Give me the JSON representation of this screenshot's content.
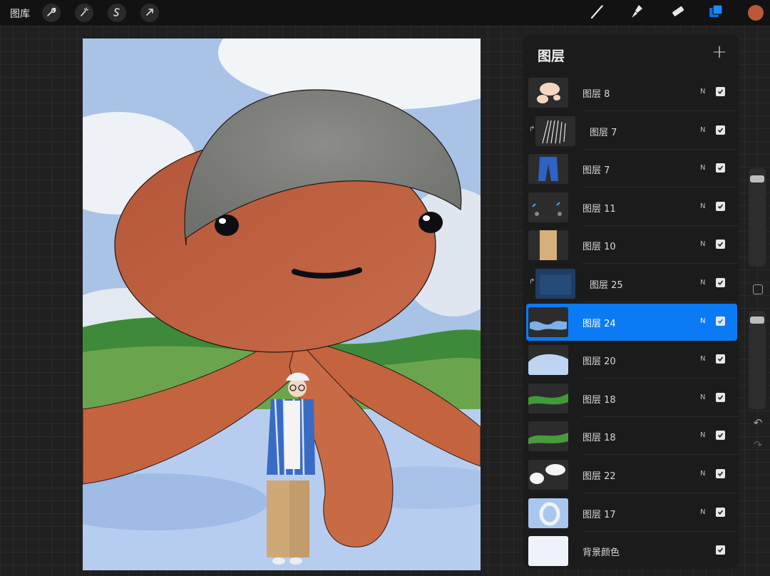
{
  "toolbar": {
    "gallery_label": "图库",
    "tools_left": [
      "wrench-icon",
      "magic-wand-icon",
      "selection-icon",
      "transform-arrow-icon"
    ],
    "tools_right": [
      "brush-icon",
      "smudge-icon",
      "eraser-icon",
      "layers-icon"
    ],
    "current_color": "#b85a3a"
  },
  "layers_panel": {
    "title": "图层",
    "add_label": "+",
    "layers": [
      {
        "name": "图层 8",
        "mode": "N",
        "visible": true,
        "clipped": false,
        "selected": false,
        "thumb": "skin-patches"
      },
      {
        "name": "图层 7",
        "mode": "N",
        "visible": true,
        "clipped": true,
        "selected": false,
        "thumb": "stripes"
      },
      {
        "name": "图层 7",
        "mode": "N",
        "visible": true,
        "clipped": false,
        "selected": false,
        "thumb": "blue-shirt"
      },
      {
        "name": "图层 11",
        "mode": "N",
        "visible": true,
        "clipped": false,
        "selected": false,
        "thumb": "dark-details"
      },
      {
        "name": "图层 10",
        "mode": "N",
        "visible": true,
        "clipped": false,
        "selected": false,
        "thumb": "khaki-pants"
      },
      {
        "name": "图层 25",
        "mode": "N",
        "visible": true,
        "clipped": true,
        "selected": false,
        "thumb": "blue-texture"
      },
      {
        "name": "图层 24",
        "mode": "N",
        "visible": true,
        "clipped": false,
        "selected": true,
        "thumb": "water"
      },
      {
        "name": "图层 20",
        "mode": "N",
        "visible": true,
        "clipped": false,
        "selected": false,
        "thumb": "light-sky"
      },
      {
        "name": "图层 18",
        "mode": "N",
        "visible": true,
        "clipped": false,
        "selected": false,
        "thumb": "green-hill"
      },
      {
        "name": "图层 18",
        "mode": "N",
        "visible": true,
        "clipped": false,
        "selected": false,
        "thumb": "green-hill-2"
      },
      {
        "name": "图层 22",
        "mode": "N",
        "visible": true,
        "clipped": false,
        "selected": false,
        "thumb": "clouds"
      },
      {
        "name": "图层 17",
        "mode": "N",
        "visible": true,
        "clipped": false,
        "selected": false,
        "thumb": "blue-ring"
      },
      {
        "name": "背景颜色",
        "mode": "",
        "visible": true,
        "clipped": false,
        "selected": false,
        "thumb": "background"
      }
    ]
  },
  "sidebar": {
    "brush_size_level": 0.05,
    "opacity_level": 0.03
  }
}
